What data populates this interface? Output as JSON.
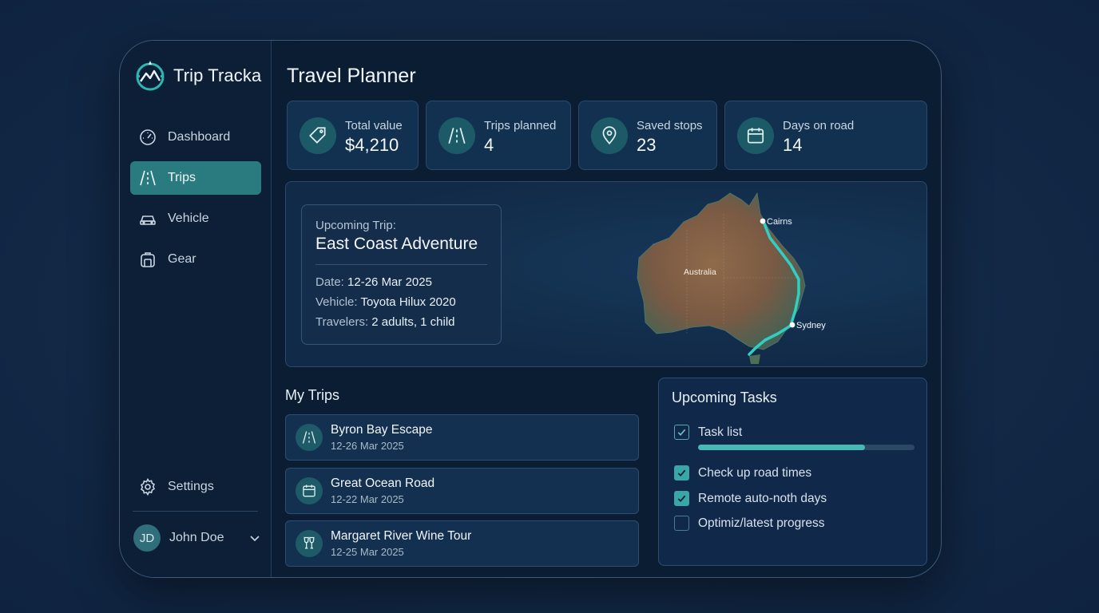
{
  "brand": {
    "name": "Trip Tracka"
  },
  "sidebar": {
    "items": [
      {
        "label": "Dashboard",
        "icon": "gauge-icon"
      },
      {
        "label": "Trips",
        "icon": "road-icon",
        "active": true
      },
      {
        "label": "Vehicle",
        "icon": "car-icon"
      },
      {
        "label": "Gear",
        "icon": "backpack-icon"
      }
    ],
    "settings_label": "Settings",
    "user": {
      "initials": "JD",
      "name": "John Doe"
    }
  },
  "main": {
    "title": "Travel Planner",
    "stats": [
      {
        "label": "Total value",
        "value": "$4,210",
        "icon": "tag-icon"
      },
      {
        "label": "Trips planned",
        "value": "4",
        "icon": "road-icon"
      },
      {
        "label": "Saved stops",
        "value": "23",
        "icon": "map-pin-icon"
      },
      {
        "label": "Days on road",
        "value": "14",
        "icon": "calendar-icon"
      }
    ],
    "upcoming": {
      "prefix": "Upcoming Trip:",
      "title": "East Coast Adventure",
      "date_label": "Date:",
      "date": "12-26 Mar 2025",
      "vehicle_label": "Vehicle:",
      "vehicle": "Toyota Hilux 2020",
      "travelers_label": "Travelers:",
      "travelers": "2 adults, 1 child"
    },
    "map": {
      "country_label": "Australia",
      "start": "Cairns",
      "end": "Sydney",
      "route_color": "#2fd0c3"
    },
    "my_trips": {
      "title": "My Trips",
      "items": [
        {
          "name": "Byron Bay Escape",
          "date": "12-26 Mar 2025",
          "icon": "road-icon"
        },
        {
          "name": "Great Ocean Road",
          "date": "12-22 Mar 2025",
          "icon": "calendar-icon"
        },
        {
          "name": "Margaret River Wine Tour",
          "date": "12-25 Mar 2025",
          "icon": "wine-glasses-icon"
        }
      ]
    },
    "tasks": {
      "title": "Upcoming Tasks",
      "progress": 0.77,
      "items": [
        {
          "label": "Task list",
          "checked": true
        },
        {
          "label": "Check up road times",
          "checked": true
        },
        {
          "label": "Remote auto-noth days",
          "checked": true
        },
        {
          "label": "Optimiz/latest progress",
          "checked": false
        }
      ]
    }
  },
  "colors": {
    "accent": "#2a7b80",
    "panel": "#123050",
    "background": "#0b1d33"
  }
}
